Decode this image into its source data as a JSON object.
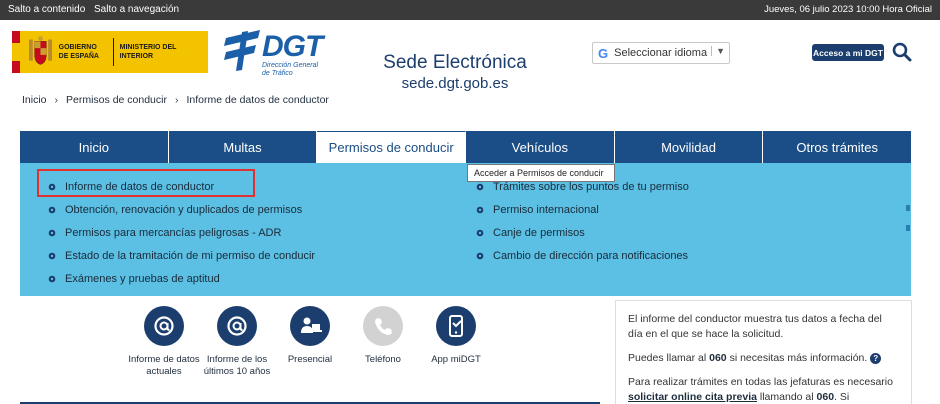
{
  "topbar": {
    "skip_content": "Salto a contenido",
    "skip_nav": "Salto a navegación",
    "date": "Jueves, 06 julio 2023 10:00 Hora Oficial"
  },
  "header": {
    "gob_text": "GOBIERNO DE ESPAÑA",
    "ministry_text": "MINISTERIO DEL INTERIOR",
    "dgt_word": "DGT",
    "dgt_sub": "Dirección General de Tráfico",
    "sede_title": "Sede Electrónica",
    "sede_domain": "sede.dgt.gob.es",
    "lang_label": "Seleccionar idioma",
    "lang_dd": "▼",
    "access_label": "Acceso a mi DGT"
  },
  "breadcrumb": [
    "Inicio",
    "Permisos de conducir",
    "Informe de datos de conductor"
  ],
  "nav": [
    "Inicio",
    "Multas",
    "Permisos de conducir",
    "Vehículos",
    "Movilidad",
    "Otros trámites"
  ],
  "tooltip": "Acceder a Permisos de conducir",
  "menu": {
    "left": [
      "Informe de datos de conductor",
      "Obtención, renovación y duplicados de permisos",
      "Permisos para mercancías peligrosas - ADR",
      "Estado de la tramitación de mi permiso de conducir",
      "Exámenes y pruebas de aptitud"
    ],
    "right": [
      "Trámites sobre los puntos de tu permiso",
      "Permiso internacional",
      "Canje de permisos",
      "Cambio de dirección para notificaciones"
    ]
  },
  "quick": [
    {
      "label": "Informe de datos actuales",
      "icon": "at-icon"
    },
    {
      "label": "Informe de los últimos 10 años",
      "icon": "at-icon"
    },
    {
      "label": "Presencial",
      "icon": "person-desk-icon"
    },
    {
      "label": "Teléfono",
      "icon": "phone-icon"
    },
    {
      "label": "App miDGT",
      "icon": "mobile-app-icon"
    }
  ],
  "info": {
    "p1": "El informe del conductor muestra tus datos a fecha del día en el que se hace la solicitud.",
    "p2_pre": "Puedes llamar al ",
    "p2_num": "060",
    "p2_post": " si necesitas más información.",
    "p3_pre": "Para realizar trámites en todas las jefaturas es necesario ",
    "p3_link": "solicitar online cita previa",
    "p3_mid": " llamando al ",
    "p3_num": "060",
    "p3_post": ". Si"
  },
  "colors": {
    "nav_bg": "#1b4e86",
    "dropdown_bg": "#5bc0e3",
    "brand_dark": "#1c3e6e",
    "highlight": "#e0312f",
    "gob_yellow": "#f3c300"
  }
}
